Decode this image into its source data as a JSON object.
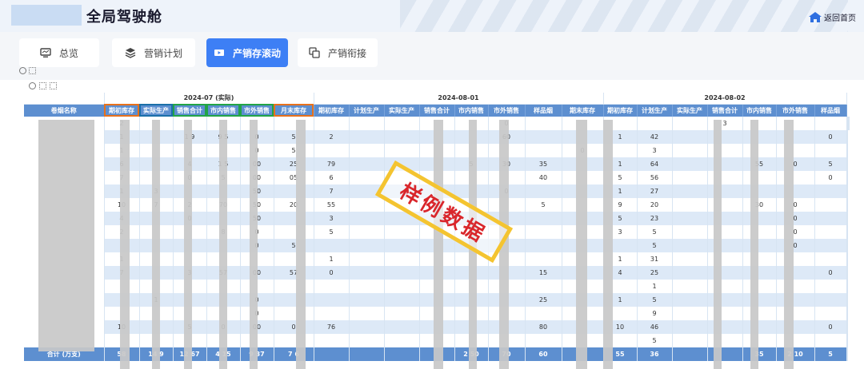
{
  "header": {
    "title": "全局驾驶舱",
    "home_label": "返回首页"
  },
  "tabs": [
    {
      "label": "总览",
      "icon": "monitor-icon",
      "active": false
    },
    {
      "label": "营销计划",
      "icon": "layers-icon",
      "active": false
    },
    {
      "label": "产销存滚动",
      "icon": "play-screen-icon",
      "active": true
    },
    {
      "label": "产销衔接",
      "icon": "copy-icon",
      "active": false
    }
  ],
  "table": {
    "name_header": "卷烟名称",
    "groups": [
      {
        "date": "2024-07 (实际)",
        "columns": [
          "期初库存",
          "实际生产",
          "销售合计",
          "市内销售",
          "市外销售",
          "月末库存"
        ]
      },
      {
        "date": "2024-08-01",
        "columns": [
          "期初库存",
          "计划生产",
          "实际生产",
          "销售合计",
          "市内销售",
          "市外销售",
          "样品烟",
          "期末库存"
        ]
      },
      {
        "date": "2024-08-02",
        "columns": [
          "期初库存",
          "计划生产",
          "实际生产",
          "销售合计",
          "市内销售",
          "市外销售",
          "样品烟"
        ]
      }
    ],
    "rows": [
      [
        "",
        "2",
        "",
        "",
        "",
        "",
        "",
        "",
        "",
        "",
        "",
        "",
        "0",
        "",
        "",
        "",
        "",
        "",
        "3",
        "",
        "",
        "",
        "",
        "",
        ""
      ],
      [
        "",
        "1",
        "",
        "1 9",
        "9 5",
        "0",
        "5",
        "2",
        "",
        "",
        "",
        "",
        "60",
        "",
        "",
        "1",
        "42",
        "",
        "",
        "",
        "",
        "0",
        ""
      ],
      [
        "",
        "1",
        "",
        "",
        "",
        "0",
        "5",
        "",
        "",
        "",
        "",
        "",
        "",
        "",
        "0",
        "",
        "3",
        "",
        "",
        "",
        "",
        "",
        ""
      ],
      [
        "",
        "6",
        "",
        "4",
        "1 5",
        "00",
        "25",
        "79",
        "",
        "",
        "",
        "5",
        "30",
        "35",
        "",
        "1",
        "64",
        "",
        "",
        "55",
        "0",
        "5",
        ""
      ],
      [
        "",
        "7",
        "",
        "0",
        "5",
        "00",
        "05",
        "6",
        "",
        "",
        "",
        "",
        "",
        "40",
        "",
        "5",
        "56",
        "",
        "",
        "",
        "",
        "0",
        ""
      ],
      [
        "",
        "1",
        "3",
        "",
        "",
        "50",
        "",
        "7",
        "",
        "",
        "",
        "",
        "0",
        "",
        "",
        "1",
        "27",
        "",
        "",
        "",
        "",
        "",
        ""
      ],
      [
        "",
        "10",
        "7",
        "2",
        "70",
        "50",
        "20",
        "55",
        "",
        "",
        "",
        "",
        "",
        "5",
        "",
        "9",
        "20",
        "",
        "",
        "30",
        "0",
        "",
        ""
      ],
      [
        "",
        "4",
        "",
        "0",
        "",
        "50",
        "",
        "3",
        "",
        "",
        "",
        "",
        "",
        "",
        "",
        "5",
        "23",
        "",
        "",
        "",
        "0",
        "",
        ""
      ],
      [
        "",
        "2",
        "",
        "",
        "8",
        "0",
        "",
        "5",
        "",
        "",
        "",
        "",
        "",
        "",
        "",
        "3",
        "5",
        "",
        "",
        "",
        "0",
        "",
        ""
      ],
      [
        "",
        "",
        "",
        "",
        "",
        "0",
        "5",
        "",
        "",
        "",
        "",
        "",
        "",
        "",
        "",
        "",
        "5",
        "",
        "",
        "",
        "0",
        "",
        ""
      ],
      [
        "",
        "1",
        "",
        "",
        "",
        "",
        "",
        "1",
        "",
        "",
        "",
        "",
        "",
        "",
        "",
        "1",
        "31",
        "",
        "",
        "",
        "",
        "",
        ""
      ],
      [
        "",
        "7",
        "",
        "3",
        "57",
        "00",
        "57",
        "0",
        "",
        "",
        "",
        "",
        "",
        "15",
        "",
        "4",
        "25",
        "",
        "",
        "",
        "",
        "0",
        ""
      ],
      [
        "",
        "",
        "",
        "",
        "",
        "",
        "",
        "",
        "",
        "",
        "",
        "",
        "",
        "",
        "",
        "",
        "1",
        "",
        "",
        "",
        "",
        "",
        ""
      ],
      [
        "",
        "",
        "1",
        "",
        "",
        "0",
        "",
        "",
        "",
        "",
        "",
        "",
        "",
        "25",
        "",
        "1",
        "5",
        "",
        "",
        "",
        "",
        "",
        ""
      ],
      [
        "",
        "",
        "",
        "",
        "",
        "0",
        "",
        "",
        "",
        "",
        "",
        "",
        "",
        "",
        "",
        "",
        "9",
        "",
        "",
        "",
        "",
        "",
        ""
      ],
      [
        "",
        "10",
        "",
        "5",
        "0",
        "00",
        "0",
        "76",
        "",
        "",
        "",
        "",
        "",
        "80",
        "",
        "10",
        "46",
        "",
        "",
        "",
        "",
        "0",
        ""
      ],
      [
        "",
        "",
        "",
        "",
        "",
        "",
        "",
        "",
        "",
        "",
        "",
        "",
        "",
        "",
        "",
        "",
        "5",
        "",
        "",
        "",
        "",
        "",
        ""
      ]
    ],
    "total_row": [
      "合计 (万支)",
      "58",
      "14 9",
      "12 67",
      "4 15",
      "9 37",
      "7 6",
      "",
      "",
      "",
      "",
      "2 50",
      "70",
      "60",
      "",
      "55",
      "36",
      "",
      "",
      "35",
      "2 10",
      "5",
      ""
    ]
  },
  "watermark": "样例数据",
  "colors": {
    "header_blue": "#5d8fd0",
    "active_tab": "#3d7ff5",
    "row_alt": "#dde9f7",
    "highlight_orange": "#e8711b",
    "highlight_blue": "#1b6fa8",
    "highlight_green": "#22a447",
    "watermark_border": "#f4c430",
    "watermark_text": "#d9262b"
  }
}
